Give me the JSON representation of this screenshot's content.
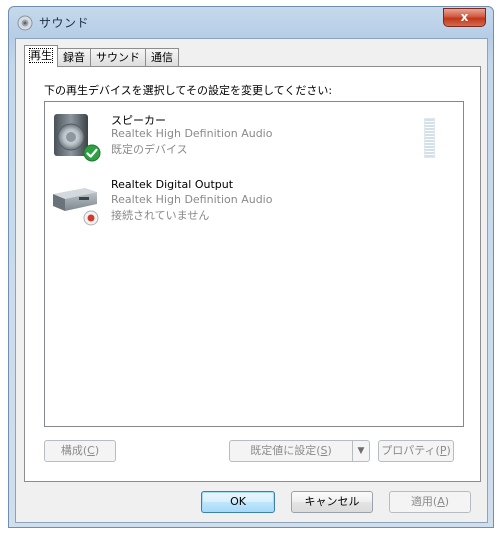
{
  "window": {
    "title": "サウンド",
    "close_label": "x"
  },
  "tabs": [
    {
      "label": "再生",
      "active": true
    },
    {
      "label": "録音",
      "active": false
    },
    {
      "label": "サウンド",
      "active": false
    },
    {
      "label": "通信",
      "active": false
    }
  ],
  "panel": {
    "instruction": "下の再生デバイスを選択してその設定を変更してください:"
  },
  "devices": [
    {
      "name": "スピーカー",
      "driver": "Realtek High Definition Audio",
      "status": "既定のデバイス",
      "icon": "speaker-icon",
      "badge": "default-check-icon"
    },
    {
      "name": "Realtek Digital Output",
      "driver": "Realtek High Definition Audio",
      "status": "接続されていません",
      "icon": "digital-output-icon",
      "badge": "disconnected-icon"
    }
  ],
  "buttons": {
    "configure": {
      "text": "構成(",
      "key": "C",
      "end": ")"
    },
    "set_default": {
      "text": "既定値に設定(",
      "key": "S",
      "end": ")"
    },
    "properties": {
      "text": "プロパティ(",
      "key": "P",
      "end": ")"
    },
    "ok": "OK",
    "cancel": "キャンセル",
    "apply": {
      "text": "適用(",
      "key": "A",
      "end": ")"
    }
  },
  "colors": {
    "accent": "#3c7fb1",
    "close": "#c1361c",
    "default_check": "#2ea043",
    "disconnected": "#d23a2a"
  }
}
